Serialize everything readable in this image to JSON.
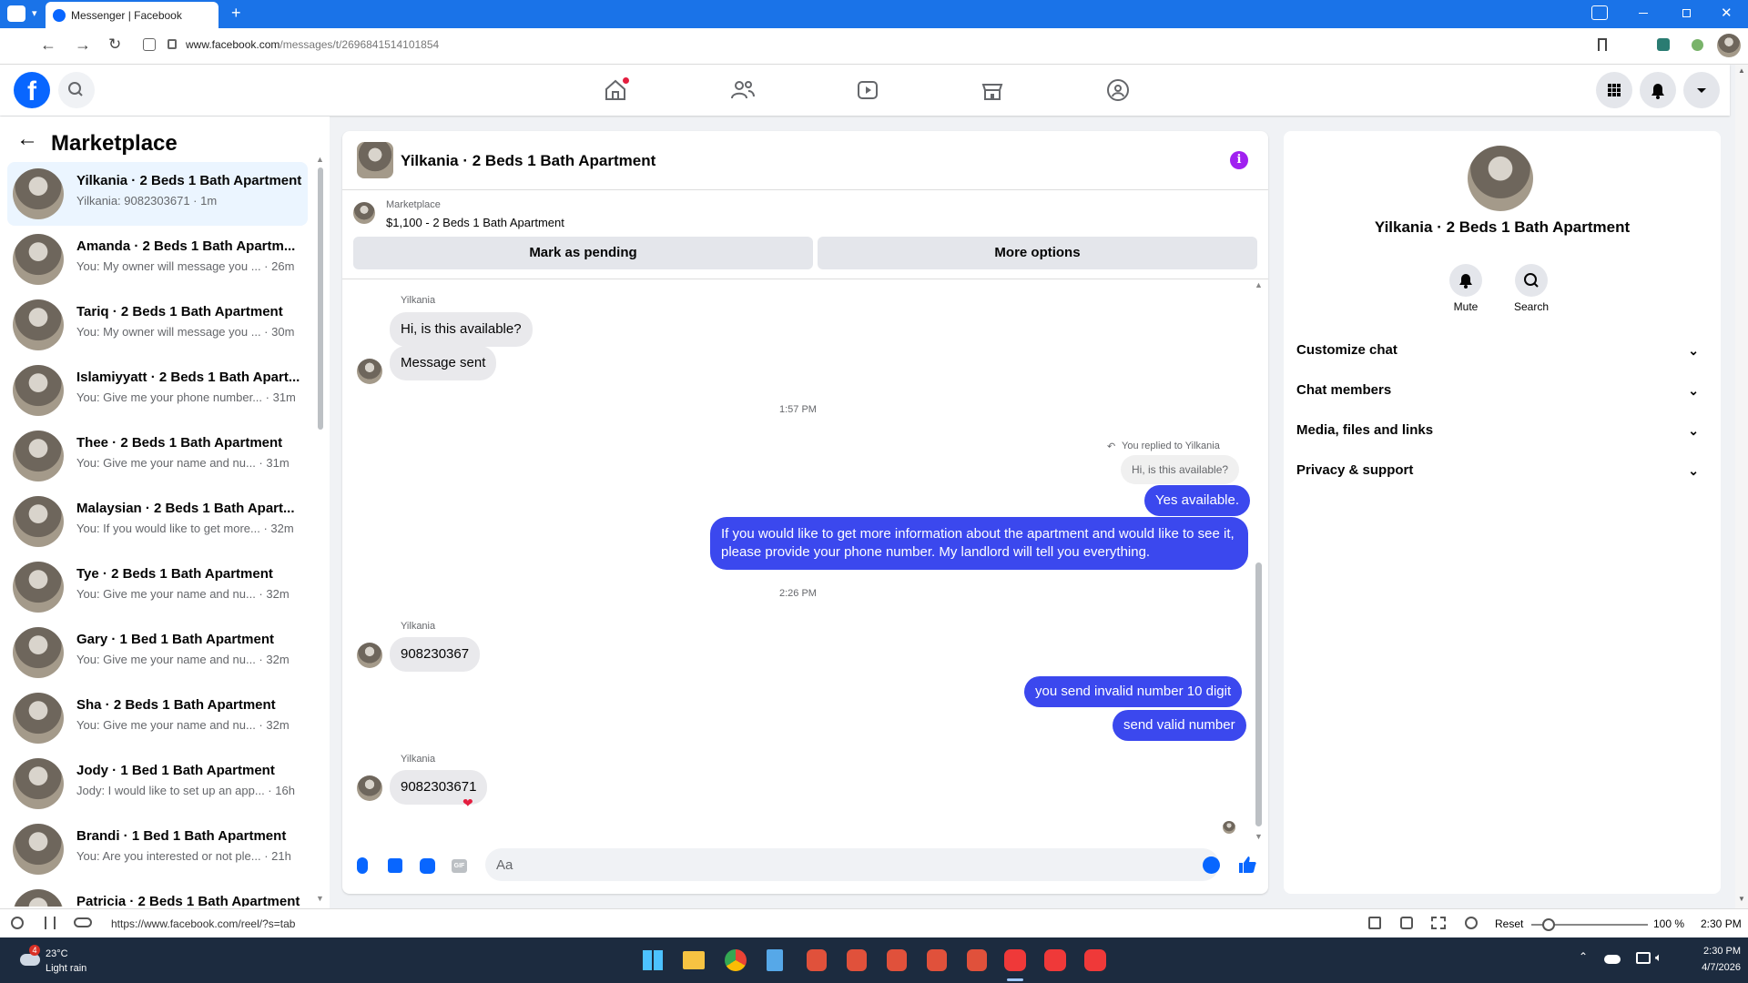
{
  "browser": {
    "tab_title": "Messenger | Facebook",
    "url_prefix": "www.facebook.com",
    "url_path": "/messages/t/2696841514101854"
  },
  "left": {
    "title": "Marketplace",
    "conversations": [
      {
        "name": "Yilkania · 2 Beds 1 Bath Apartment",
        "preview": "Yilkania: 9082303671 · 1m",
        "active": true
      },
      {
        "name": "Amanda · 2 Beds 1 Bath Apartm...",
        "preview": "You: My owner will message you ... · 26m"
      },
      {
        "name": "Tariq · 2 Beds 1 Bath Apartment",
        "preview": "You: My owner will message you ... · 30m"
      },
      {
        "name": "Islamiyyatt · 2 Beds 1 Bath Apart...",
        "preview": "You: Give me your phone number... · 31m"
      },
      {
        "name": "Thee · 2 Beds 1 Bath Apartment",
        "preview": "You: Give me your name and nu... · 31m"
      },
      {
        "name": "Malaysian · 2 Beds 1 Bath Apart...",
        "preview": "You: If you would like to get more... · 32m"
      },
      {
        "name": "Tye · 2 Beds 1 Bath Apartment",
        "preview": "You: Give me your name and nu... · 32m"
      },
      {
        "name": "Gary · 1 Bed 1 Bath Apartment",
        "preview": "You: Give me your name and nu... · 32m"
      },
      {
        "name": "Sha · 2 Beds 1 Bath Apartment",
        "preview": "You: Give me your name and nu... · 32m"
      },
      {
        "name": "Jody · 1 Bed 1 Bath Apartment",
        "preview": "Jody: I would like to set up an app... · 16h"
      },
      {
        "name": "Brandi · 1 Bed 1 Bath Apartment",
        "preview": "You: Are you interested or not ple... · 21h"
      },
      {
        "name": "Patricia · 2 Beds 1 Bath Apartment",
        "preview": ""
      }
    ]
  },
  "chat": {
    "title": "Yilkania · 2 Beds 1 Bath Apartment",
    "listing_label": "Marketplace",
    "listing_text": "$1,100 - 2 Beds 1 Bath Apartment",
    "btn_pending": "Mark as pending",
    "btn_more": "More options",
    "sender1": "Yilkania",
    "msg1": "Hi, is this available?",
    "msg2": "Message sent",
    "time1": "1:57 PM",
    "replied_to": "You replied to Yilkania",
    "quoted": "Hi, is this available?",
    "out1": "Yes available.",
    "out2": "If you would like to get more information about the apartment and would like to see it, please provide your phone number. My landlord will tell you everything.",
    "time2": "2:26 PM",
    "sender2": "Yilkania",
    "msg3": "908230367",
    "out3": "you send invalid number 10 digit",
    "out4": "send valid number",
    "sender3": "Yilkania",
    "msg4": "9082303671",
    "reaction": "❤",
    "composer_placeholder": "Aa"
  },
  "right": {
    "title": "Yilkania · 2 Beds 1 Bath Apartment",
    "mute": "Mute",
    "search": "Search",
    "items": [
      "Customize chat",
      "Chat members",
      "Media, files and links",
      "Privacy & support"
    ]
  },
  "status": {
    "link": "https://www.facebook.com/reel/?s=tab",
    "reset": "Reset",
    "zoom": "100 %",
    "time": "2:30 PM"
  },
  "taskbar": {
    "temp": "23°C",
    "weather": "Light rain",
    "badge": "4",
    "time": "2:30 PM",
    "date": "4/7/2026"
  },
  "colors": {
    "accent": "#3b48ee",
    "fb_blue": "#0866ff",
    "chrome": "#1a73e8"
  }
}
